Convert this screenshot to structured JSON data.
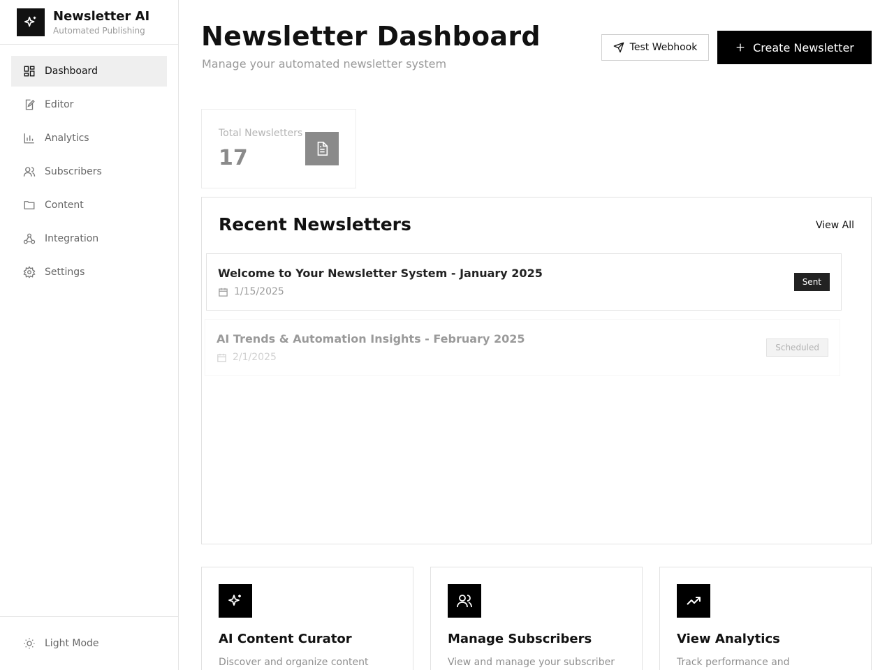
{
  "brand": {
    "name": "Newsletter AI",
    "subtitle": "Automated Publishing"
  },
  "sidebar": {
    "items": [
      {
        "label": "Dashboard",
        "icon": "dashboard-icon",
        "active": true
      },
      {
        "label": "Editor",
        "icon": "edit-icon"
      },
      {
        "label": "Analytics",
        "icon": "bar-chart-icon"
      },
      {
        "label": "Subscribers",
        "icon": "users-icon"
      },
      {
        "label": "Content",
        "icon": "folder-icon"
      },
      {
        "label": "Integration",
        "icon": "webhook-icon"
      },
      {
        "label": "Settings",
        "icon": "gear-icon"
      }
    ],
    "footer": {
      "label": "Light Mode",
      "icon": "sun-icon"
    }
  },
  "header": {
    "title": "Newsletter Dashboard",
    "subtitle": "Manage your automated newsletter system",
    "test_webhook_label": "Test Webhook",
    "create_label": "Create Newsletter"
  },
  "stats": {
    "total_label": "Total Newsletters",
    "total_value": "17"
  },
  "recent": {
    "title": "Recent Newsletters",
    "view_all": "View All",
    "items": [
      {
        "title": "Welcome to Your Newsletter System - January 2025",
        "date": "1/15/2025",
        "status": "Sent"
      },
      {
        "title": "AI Trends & Automation Insights - February 2025",
        "date": "2/1/2025",
        "status": "Scheduled"
      }
    ]
  },
  "quick_actions": [
    {
      "title": "AI Content Curator",
      "desc": "Discover and organize content",
      "icon": "sparkles-icon"
    },
    {
      "title": "Manage Subscribers",
      "desc": "View and manage your subscriber",
      "icon": "users-icon"
    },
    {
      "title": "View Analytics",
      "desc": "Track performance and",
      "icon": "trending-up-icon"
    }
  ],
  "colors": {
    "accent": "#000000",
    "muted": "#9a9a9a",
    "active_bg": "#efefef"
  }
}
